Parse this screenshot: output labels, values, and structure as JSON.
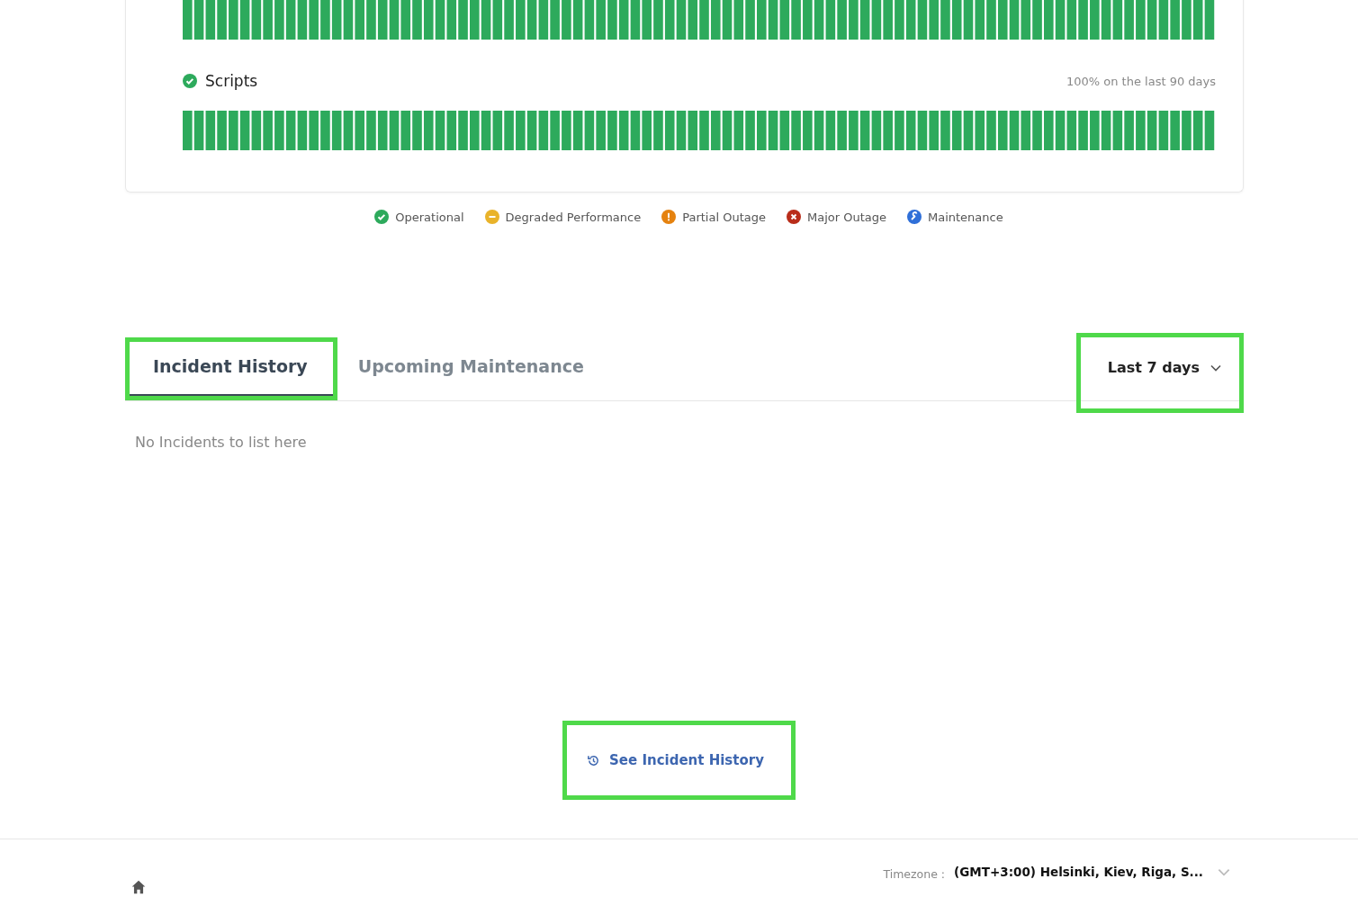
{
  "components": [
    {
      "name": "Scripts",
      "uptime": "100% on the last 90 days"
    }
  ],
  "legend": [
    {
      "kind": "operational",
      "label": "Operational"
    },
    {
      "kind": "degraded",
      "label": "Degraded Performance"
    },
    {
      "kind": "partial",
      "label": "Partial Outage"
    },
    {
      "kind": "major",
      "label": "Major Outage"
    },
    {
      "kind": "maintenance",
      "label": "Maintenance"
    }
  ],
  "tabs": [
    {
      "label": "Incident History",
      "selected": true,
      "highlighted": true
    },
    {
      "label": "Upcoming Maintenance",
      "selected": false,
      "highlighted": false
    }
  ],
  "range_dropdown": {
    "value": "Last 7 days",
    "highlighted": true
  },
  "empty_message": "No Incidents to list here",
  "history_button": {
    "label": "See Incident History",
    "highlighted": true
  },
  "footer": {
    "timezone_label": "Timezone :",
    "timezone_value": "(GMT+3:00) Helsinki, Kiev, Riga, S..."
  }
}
